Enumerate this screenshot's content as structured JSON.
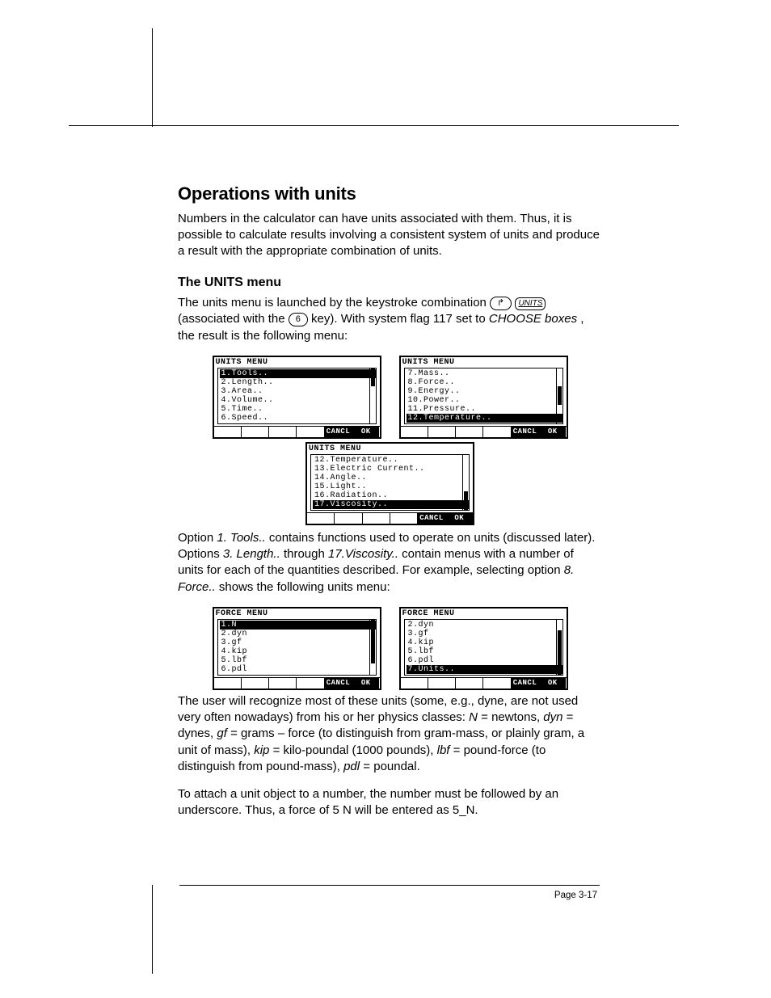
{
  "page_number": "Page 3-17",
  "h1": "Operations with units",
  "intro": "Numbers in the calculator can have units associated with them.  Thus, it is possible to calculate results involving a consistent system of units and produce a result with the appropriate combination of units.",
  "h2": "The UNITS menu",
  "units_p_a": "The units menu is launched by the keystroke combination ",
  "units_p_b": " (associated with the ",
  "units_p_c": " key).  With system flag 117 set to ",
  "units_p_choose": "CHOOSE boxes",
  "units_p_d": ", the result is the following menu:",
  "key_shift": "↱",
  "key_units": "UNITS",
  "key_six": "6",
  "menus_units": {
    "title": "UNITS MENU",
    "a": [
      "1.Tools..",
      "2.Length..",
      "3.Area..",
      "4.Volume..",
      "5.Time..",
      "6.Speed.."
    ],
    "b": [
      "7.Mass..",
      "8.Force..",
      "9.Energy..",
      "10.Power..",
      "11.Pressure..",
      "12.Temperature.."
    ],
    "c": [
      "12.Temperature..",
      "13.Electric Current..",
      "14.Angle..",
      "15.Light..",
      "16.Radiation..",
      "17.Viscosity.."
    ],
    "soft_cancel": "CANCL",
    "soft_ok": "OK"
  },
  "after_units_1a": "Option ",
  "after_units_1b": "1. Tools..",
  "after_units_1c": " contains functions used to operate on  units (discussed later). Options ",
  "after_units_1d": "3. Length..",
  "after_units_1e": "  through ",
  "after_units_1f": "17.Viscosity..",
  "after_units_1g": "  contain menus with a number of units for each of the quantities described.  For example, selecting option ",
  "after_units_1h": "8. Force..",
  "after_units_1i": " shows the following units menu:",
  "menus_force": {
    "title": "FORCE MENU",
    "a": [
      "1.N",
      "2.dyn",
      "3.gf",
      "4.kip",
      "5.lbf",
      "6.pdl"
    ],
    "b": [
      "2.dyn",
      "3.gf",
      "4.kip",
      "5.lbf",
      "6.pdl",
      "7.Units.."
    ]
  },
  "force_expl_a": "The user will recognize most of these units (some, e.g., dyne, are not used very often nowadays) from his or  her physics classes: ",
  "sym_N": "N",
  "force_expl_b": "  = newtons, ",
  "sym_dyn": "dyn",
  "force_expl_c": " = dynes, ",
  "sym_gf": "gf",
  "force_expl_d": " = grams – force (to distinguish from gram-mass, or plainly gram, a unit of mass), ",
  "sym_kip": "kip",
  "force_expl_e": " = kilo-poundal (1000 pounds), ",
  "sym_lbf": "lbf",
  "force_expl_f": " = pound-force (to distinguish from pound-mass), ",
  "sym_pdl": "pdl",
  "force_expl_g": " = poundal.",
  "attach": "To attach a unit object to a number, the number must be followed by an underscore.  Thus, a force of 5 N will be entered as 5_N."
}
